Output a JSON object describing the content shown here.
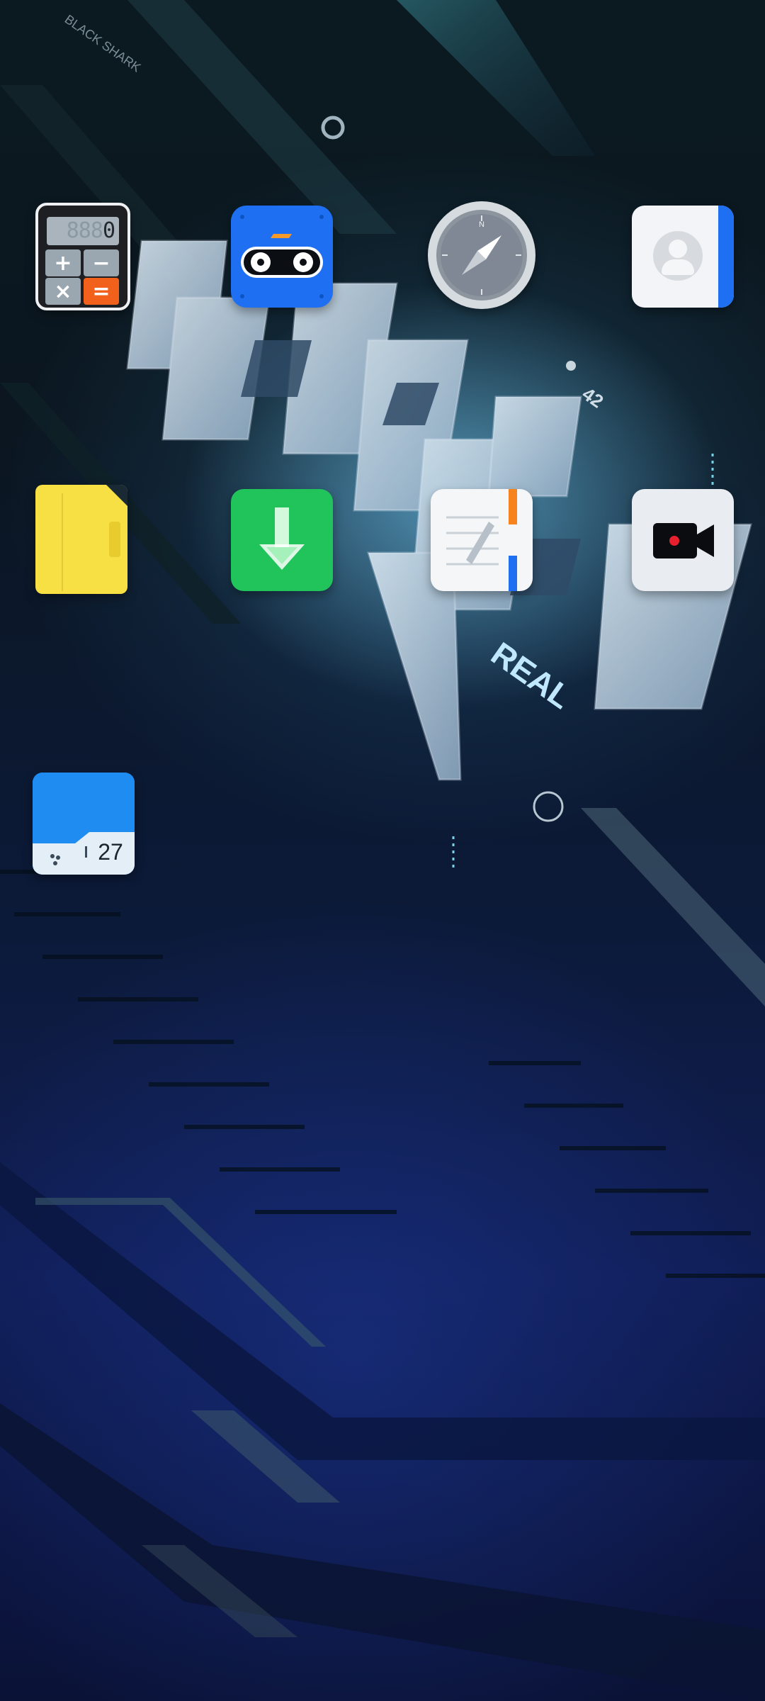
{
  "home_screen": {
    "apps": [
      {
        "name": "Calculator",
        "icon": "calculator-icon"
      },
      {
        "name": "Game Tape",
        "icon": "cassette-robot-icon"
      },
      {
        "name": "Browser",
        "icon": "compass-icon"
      },
      {
        "name": "Contacts",
        "icon": "contacts-icon"
      },
      {
        "name": "Files",
        "icon": "folder-icon"
      },
      {
        "name": "Downloads",
        "icon": "download-icon"
      },
      {
        "name": "Notes",
        "icon": "notepad-icon"
      },
      {
        "name": "Screen Recorder",
        "icon": "video-camera-icon"
      },
      {
        "name": "Weather",
        "icon": "weather-icon"
      }
    ],
    "calculator_display": {
      "dim_digits": "888",
      "value": "0"
    },
    "calculator_keys": {
      "plus": "+",
      "minus": "−",
      "times": "×",
      "equals": "="
    },
    "weather_temperature": "27",
    "compass_north_label": "N",
    "wallpaper": {
      "brand_text": "BLACK SHARK",
      "tagline": "REAL",
      "badge_number": "42"
    }
  },
  "colors": {
    "calculator_orange": "#f2611c",
    "blue_accent": "#1f6ff2",
    "green_accent": "#20c45a",
    "yellow_accent": "#f6e043",
    "record_red": "#e8202e"
  }
}
